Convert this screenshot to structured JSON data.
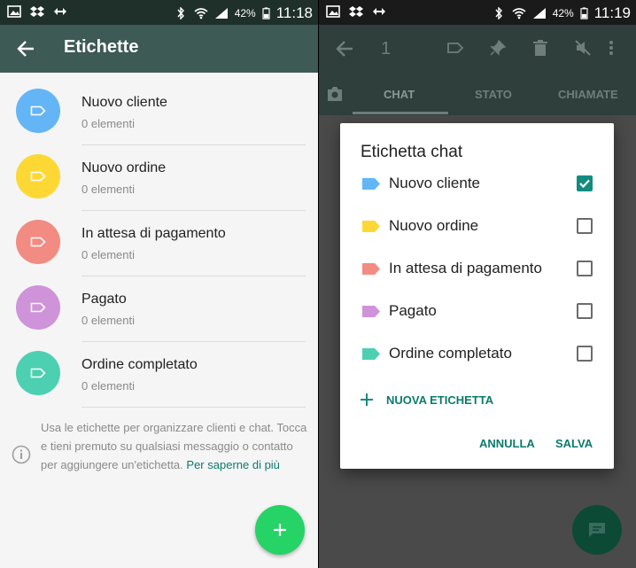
{
  "left": {
    "statusbar": {
      "battery": "42%",
      "time": "11:18"
    },
    "appbar": {
      "title": "Etichette"
    },
    "labels": [
      {
        "name": "Nuovo cliente",
        "count": "0 elementi",
        "color": "#64b5f6"
      },
      {
        "name": "Nuovo ordine",
        "count": "0 elementi",
        "color": "#fdd835"
      },
      {
        "name": "In attesa di pagamento",
        "count": "0 elementi",
        "color": "#f28b82"
      },
      {
        "name": "Pagato",
        "count": "0 elementi",
        "color": "#ce93d8"
      },
      {
        "name": "Ordine completato",
        "count": "0 elementi",
        "color": "#4dd0b1"
      }
    ],
    "hint": {
      "text": "Usa le etichette per organizzare clienti e chat. Tocca e tieni premuto su qualsiasi messaggio o contatto per aggiungere un'etichetta.",
      "link": "Per saperne di più"
    },
    "fab_icon": "plus-icon"
  },
  "right": {
    "statusbar": {
      "battery": "42%",
      "time": "11:19"
    },
    "appbar": {
      "selected_count": "1"
    },
    "tabs": [
      "CHAT",
      "STATO",
      "CHIAMATE"
    ],
    "dialog": {
      "title": "Etichetta chat",
      "options": [
        {
          "name": "Nuovo cliente",
          "checked": true,
          "color": "#64b5f6"
        },
        {
          "name": "Nuovo ordine",
          "checked": false,
          "color": "#fdd835"
        },
        {
          "name": "In attesa di pagamento",
          "checked": false,
          "color": "#f28b82"
        },
        {
          "name": "Pagato",
          "checked": false,
          "color": "#ce93d8"
        },
        {
          "name": "Ordine completato",
          "checked": false,
          "color": "#4dd0b1"
        }
      ],
      "new_label": "NUOVA ETICHETTA",
      "cancel": "ANNULLA",
      "save": "SALVA"
    }
  },
  "colors": {
    "accent": "#0b7a6e",
    "fab": "#25d366",
    "check": "#128c7e"
  }
}
